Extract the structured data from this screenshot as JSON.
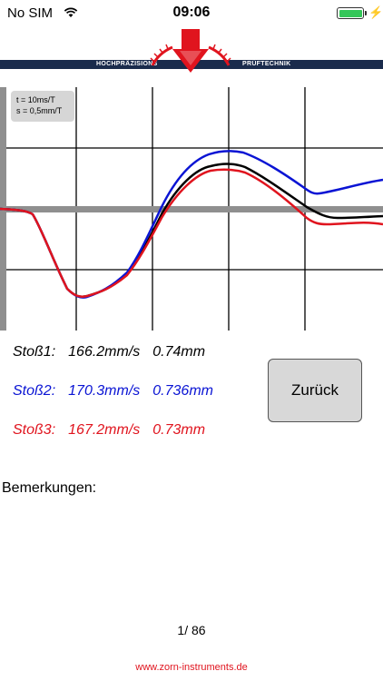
{
  "status_bar": {
    "carrier": "No SIM",
    "time": "09:06"
  },
  "header": {
    "left_text": "HOCHPRÄZISIONS",
    "right_text": "PRÜFTECHNIK",
    "colors": {
      "banner": "#1a2b4c",
      "brand_red": "#e0141e"
    }
  },
  "graph": {
    "legend": [
      "t = 10ms/T",
      "s = 0,5mm/T"
    ],
    "series_colors": {
      "black": "#000000",
      "blue": "#0a14d4",
      "red": "#e0141e"
    }
  },
  "results": [
    {
      "label": "Stoß1:",
      "speed": "166.2mm/s",
      "distance": "0.74mm",
      "color": "#000000"
    },
    {
      "label": "Stoß2:",
      "speed": "170.3mm/s",
      "distance": "0.736mm",
      "color": "#0a14d4"
    },
    {
      "label": "Stoß3:",
      "speed": "167.2mm/s",
      "distance": "0.73mm",
      "color": "#e0141e"
    }
  ],
  "buttons": {
    "back_label": "Zurück"
  },
  "remarks_label": "Bemerkungen:",
  "pager": "1/ 86",
  "footer_link": "www.zorn-instruments.de"
}
